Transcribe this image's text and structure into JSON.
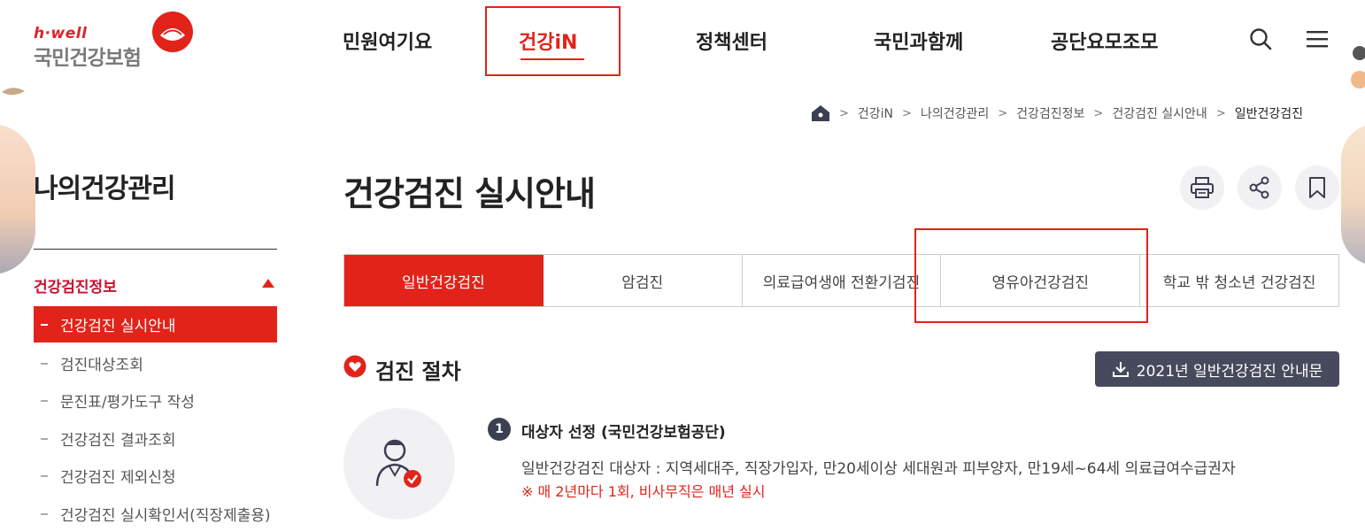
{
  "logo": {
    "hwell": "h·well",
    "name": "국민건강보험"
  },
  "nav": {
    "items": [
      "민원여기요",
      "건강iN",
      "정책센터",
      "국민과함께",
      "공단요모조모"
    ],
    "active_index": 1
  },
  "breadcrumb": [
    "건강iN",
    "나의건강관리",
    "건강검진정보",
    "건강검진 실시안내",
    "일반건강검진"
  ],
  "sidebar": {
    "title": "나의건강관리",
    "section": "건강검진정보",
    "active_item": "건강검진 실시안내",
    "items": [
      "검진대상조회",
      "문진표/평가도구 작성",
      "건강검진 결과조회",
      "건강검진 제외신청",
      "건강검진 실시확인서(직장제출용)"
    ]
  },
  "main": {
    "title": "건강검진 실시안내",
    "tabs": [
      "일반건강검진",
      "암검진",
      "의료급여생애 전환기검진",
      "영유아건강검진",
      "학교 밖 청소년 건강검진"
    ],
    "active_tab": 0,
    "section_title": "검진 절차",
    "download_label": "2021년 일반건강검진 안내문",
    "step": {
      "number": "1",
      "title": "대상자 선정 (국민건강보험공단)",
      "desc": "일반건강검진 대상자 : 지역세대주, 직장가입자, 만20세이상 세대원과 피부양자, 만19세~64세 의료급여수급권자",
      "note": "※ 매 2년마다 1회, 비사무직은 매년 실시"
    }
  },
  "colors": {
    "accent": "#e2231a",
    "dark_button": "#474a5c"
  },
  "icons": [
    "logo-mark-icon",
    "search-icon",
    "menu-icon",
    "home-icon",
    "print-icon",
    "share-icon",
    "bookmark-icon",
    "heart-icon",
    "download-icon",
    "person-check-icon"
  ]
}
